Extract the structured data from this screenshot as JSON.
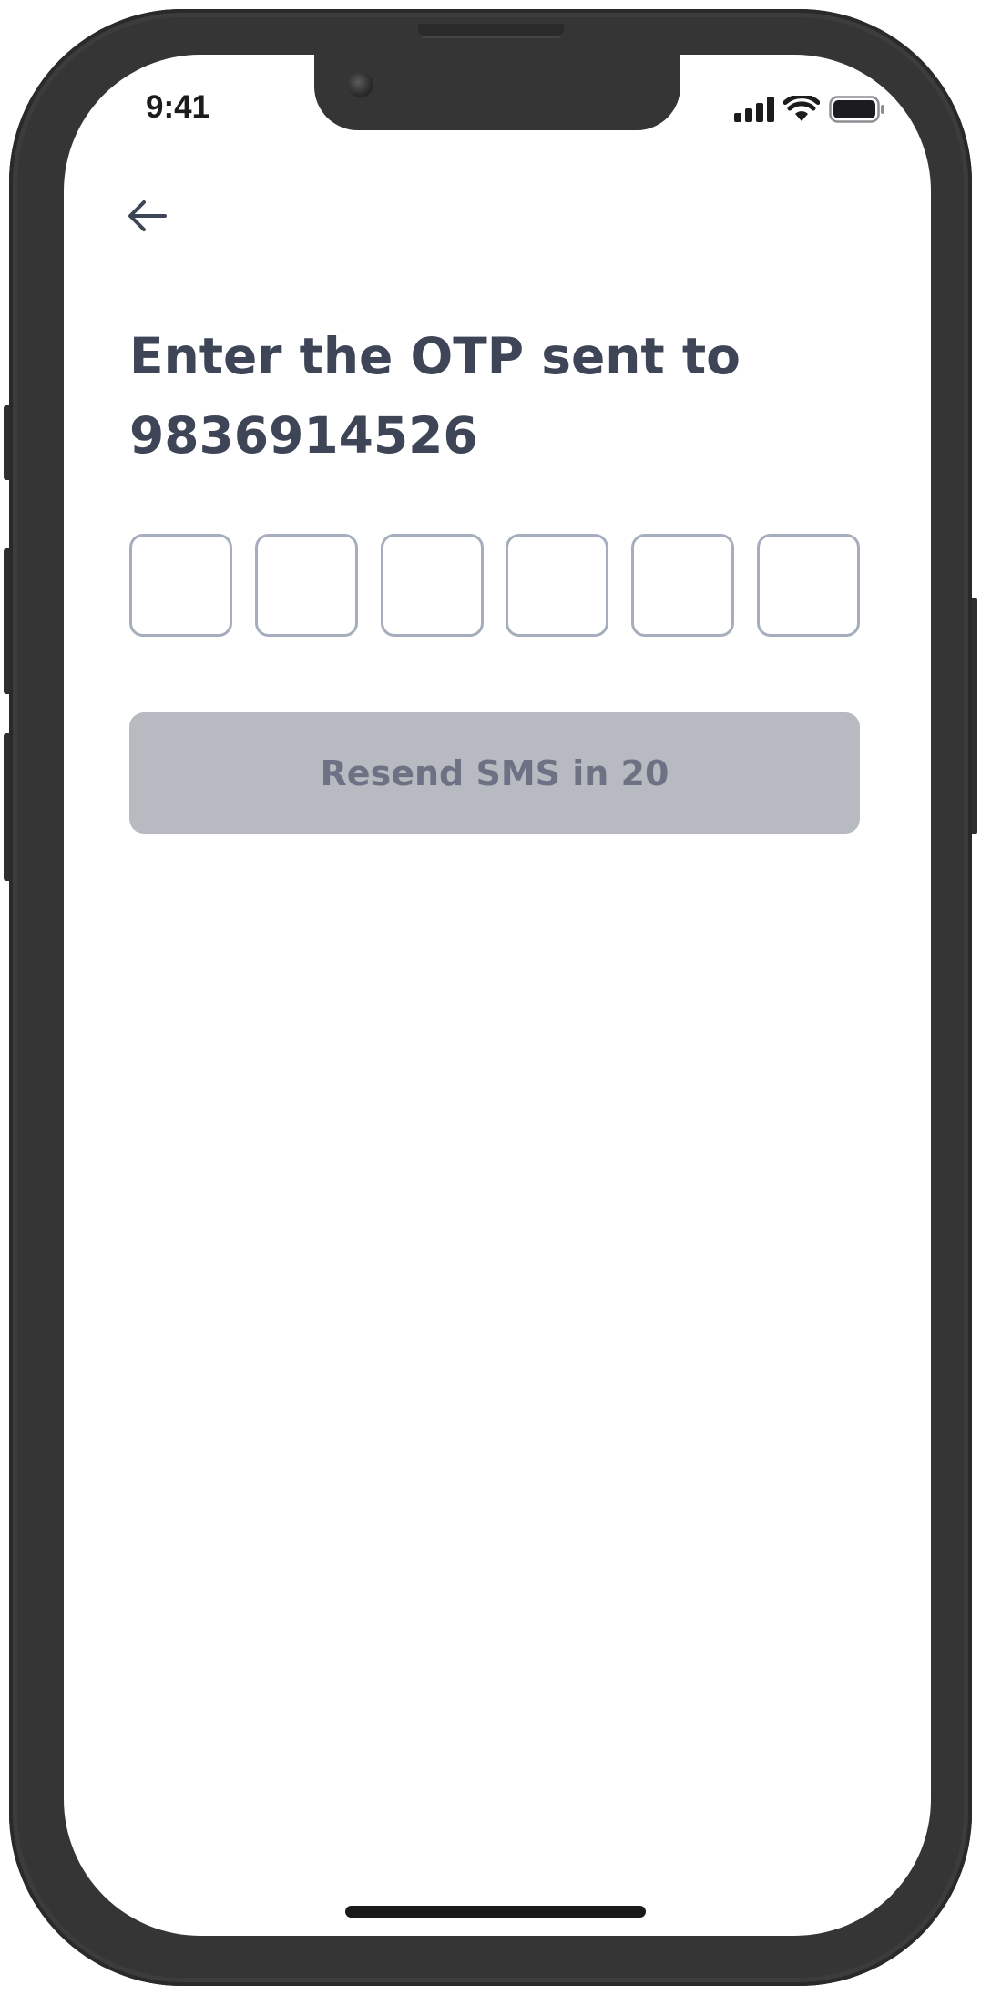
{
  "status_bar": {
    "time": "9:41",
    "icons": [
      "cellular-signal-icon",
      "wifi-icon",
      "battery-icon"
    ]
  },
  "nav": {
    "back_icon": "arrow-left-icon"
  },
  "heading": {
    "line1": "Enter the OTP sent to",
    "line2": "9836914526"
  },
  "otp": {
    "digits": [
      "",
      "",
      "",
      "",
      "",
      ""
    ]
  },
  "resend": {
    "label": "Resend SMS in 20",
    "enabled": false
  },
  "colors": {
    "heading_text": "#3d4556",
    "otp_border": "#a6aebd",
    "button_disabled_bg": "#b7bac1",
    "button_disabled_text": "#6c7283",
    "device_frame": "#353535"
  }
}
